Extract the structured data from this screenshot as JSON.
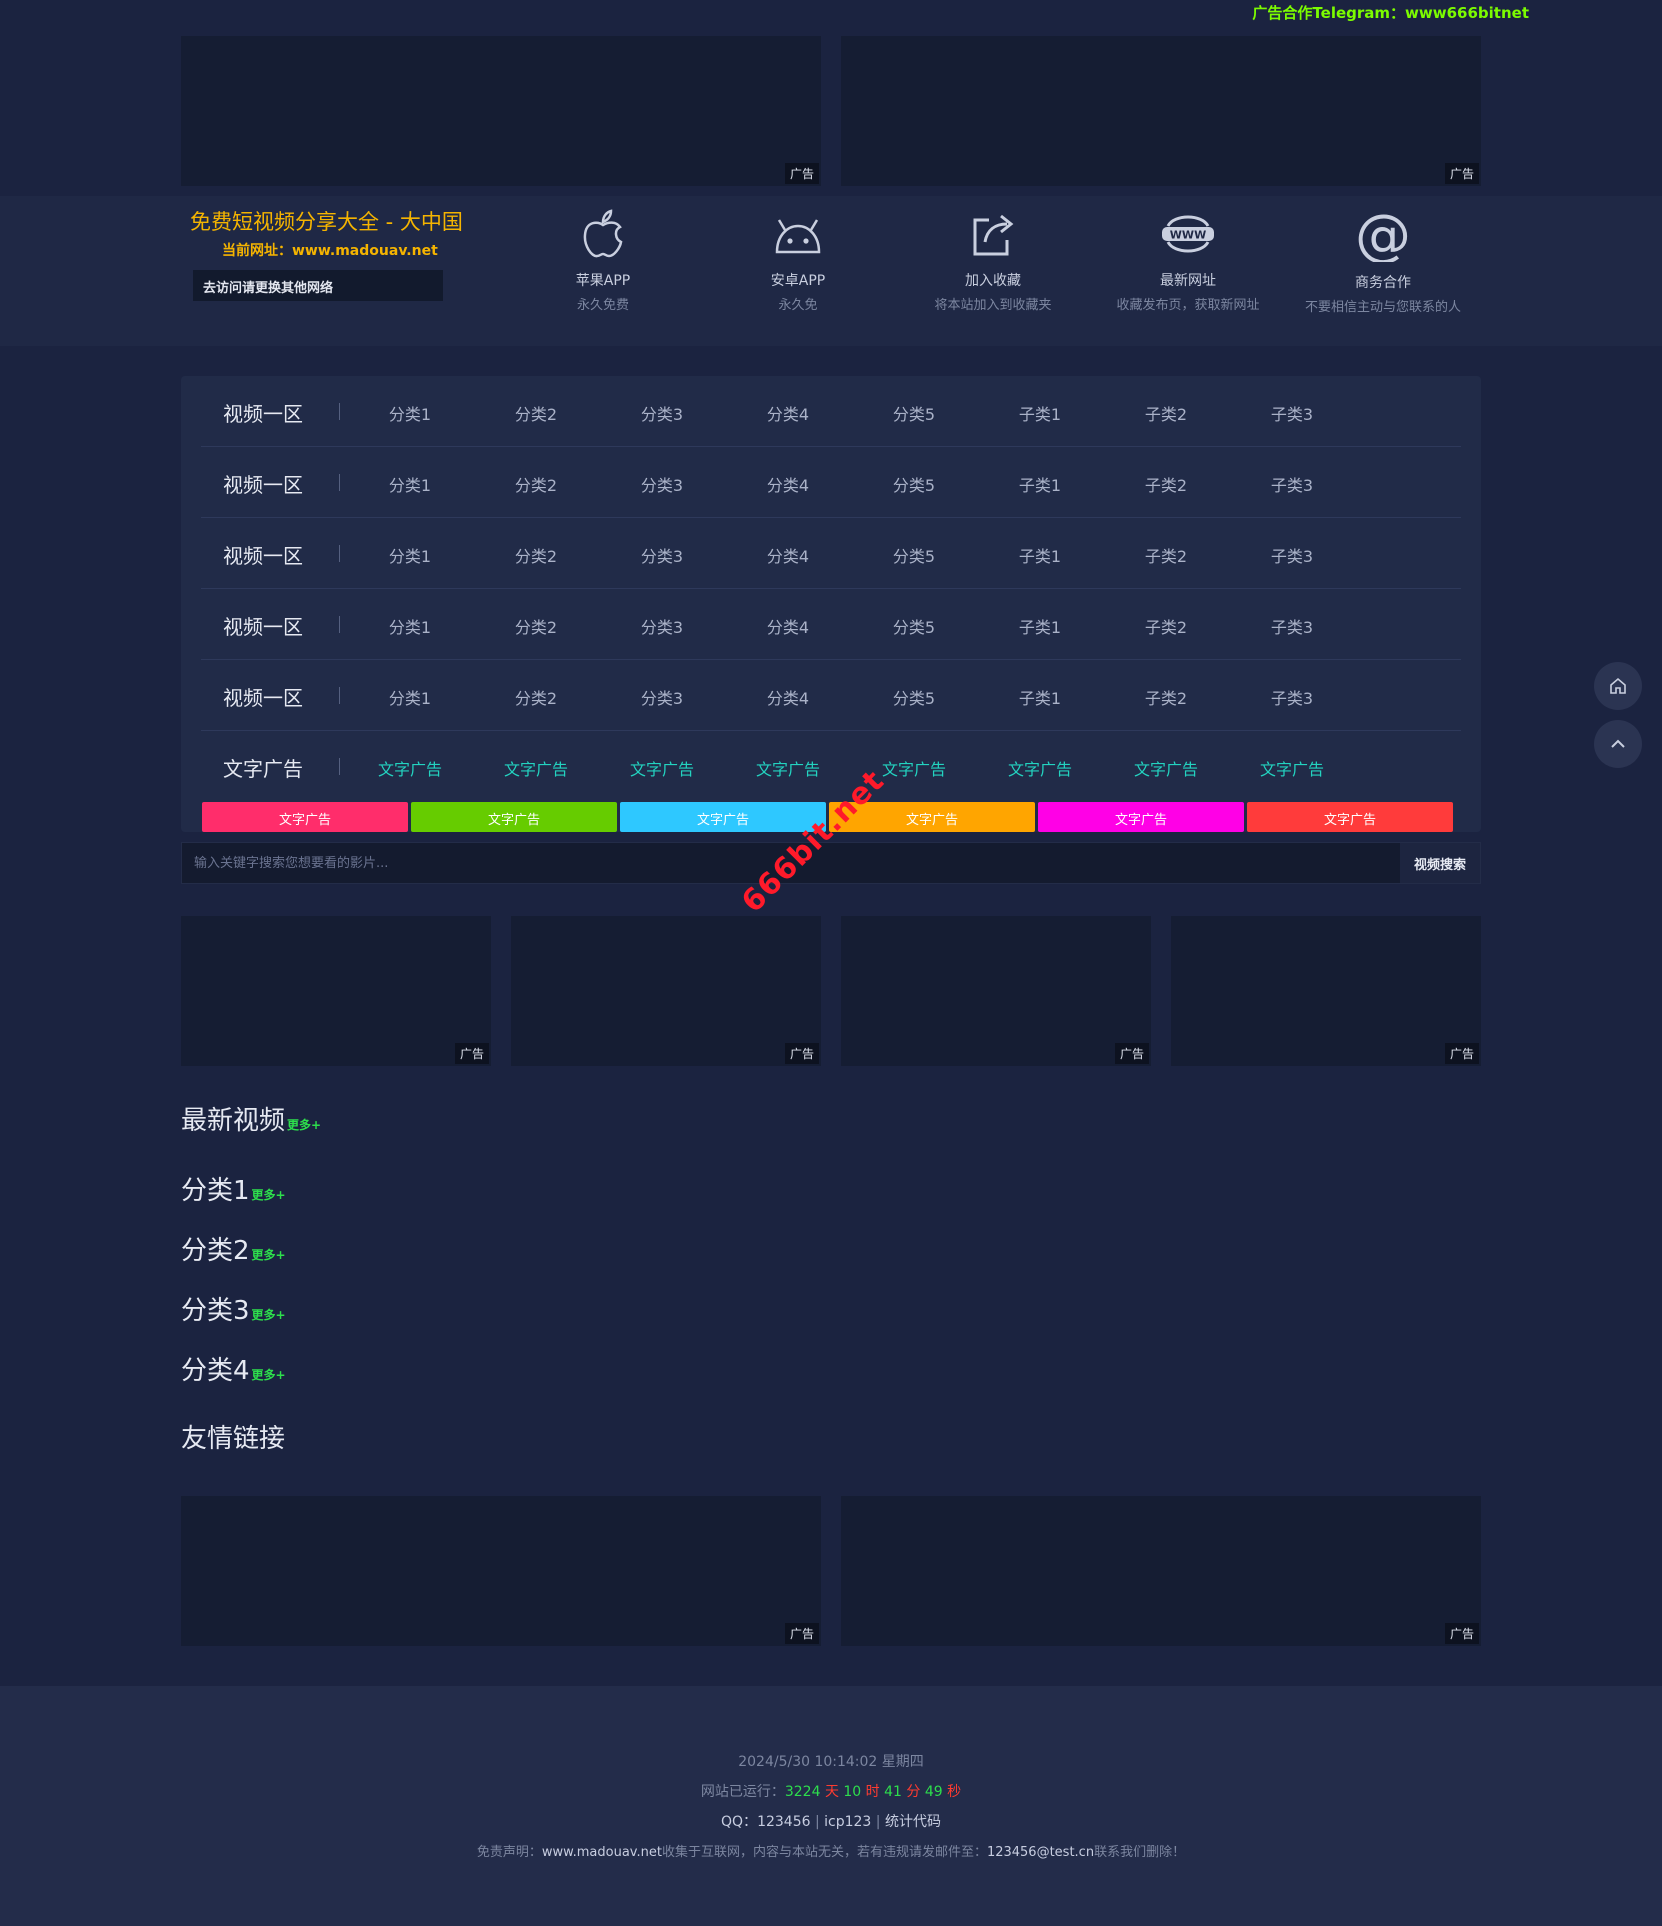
{
  "top_contact": "广告合作Telegram：www666bitnet",
  "ad_tag": "广告",
  "header": {
    "title": "免费短视频分享大全 - 大中国",
    "url_label": "当前网址：",
    "url": "www.madouav.net",
    "visit_note": "去访问请更换其他网络"
  },
  "features": [
    {
      "icon": "apple-icon",
      "title": "苹果APP",
      "subtitle": "永久免费"
    },
    {
      "icon": "android-icon",
      "title": "安卓APP",
      "subtitle": "永久免"
    },
    {
      "icon": "share-icon",
      "title": "加入收藏",
      "subtitle": "将本站加入到收藏夹"
    },
    {
      "icon": "www-icon",
      "title": "最新网址",
      "subtitle": "收藏发布页，获取新网址"
    },
    {
      "icon": "at-icon",
      "title": "商务合作",
      "subtitle": "不要相信主动与您联系的人"
    }
  ],
  "nav_rows": [
    {
      "zone": "视频一区",
      "items": [
        "分类1",
        "分类2",
        "分类3",
        "分类4",
        "分类5",
        "子类1",
        "子类2",
        "子类3"
      ]
    },
    {
      "zone": "视频一区",
      "items": [
        "分类1",
        "分类2",
        "分类3",
        "分类4",
        "分类5",
        "子类1",
        "子类2",
        "子类3"
      ]
    },
    {
      "zone": "视频一区",
      "items": [
        "分类1",
        "分类2",
        "分类3",
        "分类4",
        "分类5",
        "子类1",
        "子类2",
        "子类3"
      ]
    },
    {
      "zone": "视频一区",
      "items": [
        "分类1",
        "分类2",
        "分类3",
        "分类4",
        "分类5",
        "子类1",
        "子类2",
        "子类3"
      ]
    },
    {
      "zone": "视频一区",
      "items": [
        "分类1",
        "分类2",
        "分类3",
        "分类4",
        "分类5",
        "子类1",
        "子类2",
        "子类3"
      ]
    }
  ],
  "text_ads": {
    "zone": "文字广告",
    "items": [
      "文字广告",
      "文字广告",
      "文字广告",
      "文字广告",
      "文字广告",
      "文字广告",
      "文字广告",
      "文字广告"
    ]
  },
  "color_bars": [
    {
      "label": "文字广告",
      "color": "#ff2d6b"
    },
    {
      "label": "文字广告",
      "color": "#66cc00"
    },
    {
      "label": "文字广告",
      "color": "#2ec8ff"
    },
    {
      "label": "文字广告",
      "color": "#ffa500"
    },
    {
      "label": "文字广告",
      "color": "#ff00e6"
    },
    {
      "label": "文字广告",
      "color": "#ff3b3b"
    }
  ],
  "search": {
    "placeholder": "输入关键字搜索您想要看的影片...",
    "button": "视频搜索"
  },
  "watermark": "666bit.net",
  "sections": [
    {
      "title": "最新视频",
      "more": "更多+"
    },
    {
      "title": "分类1",
      "more": "更多+"
    },
    {
      "title": "分类2",
      "more": "更多+"
    },
    {
      "title": "分类3",
      "more": "更多+"
    },
    {
      "title": "分类4",
      "more": "更多+"
    }
  ],
  "friend_links_title": "友情链接",
  "footer": {
    "datetime": "2024/5/30 10:14:02 星期四",
    "uptime_label": "网站已运行：",
    "uptime": {
      "days": "3224",
      "days_unit": "天",
      "hours": "10",
      "hours_unit": "时",
      "minutes": "41",
      "minutes_unit": "分",
      "seconds": "49",
      "seconds_unit": "秒"
    },
    "qq_label": "QQ：",
    "qq": "123456",
    "icp": "icp123",
    "stats": "统计代码",
    "disclaimer_prefix": "免责声明：",
    "disclaimer_site": "www.madouav.net",
    "disclaimer_mid": "收集于互联网，内容与本站无关，若有违规请发邮件至：",
    "disclaimer_email": "123456@test.cn",
    "disclaimer_suffix": "联系我们删除！"
  }
}
